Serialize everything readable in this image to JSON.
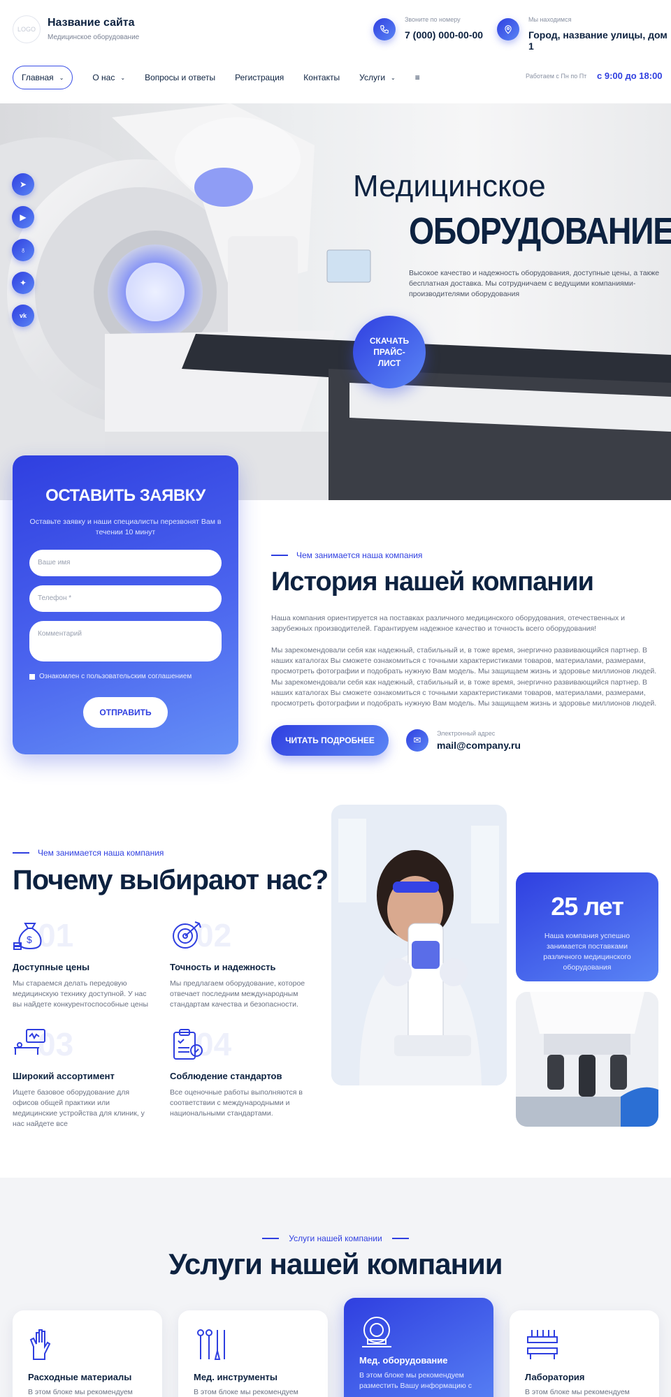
{
  "header": {
    "logo": "LOGO",
    "site_name": "Название сайта",
    "site_sub": "Медицинское оборудование",
    "phone_label": "Звоните по номеру",
    "phone": "7 (000) 000-00-00",
    "address_label": "Мы находимся",
    "address": "Город, название улицы, дом 1",
    "hours_label": "Работаем с Пн по Пт",
    "hours": "с 9:00 до 18:00",
    "nav": [
      {
        "label": "Главная"
      },
      {
        "label": "О нас"
      },
      {
        "label": "Вопросы и ответы"
      },
      {
        "label": "Регистрация"
      },
      {
        "label": "Контакты"
      },
      {
        "label": "Услуги"
      },
      {
        "label": "≡"
      }
    ]
  },
  "hero": {
    "title1": "Медицинское",
    "title2": "ОБОРУДОВАНИЕ",
    "desc": "Высокое качество и надежность оборудования, доступные цены, а также бесплатная доставка. Мы сотрудничаем с ведущими компаниями-производителями оборудования",
    "price_button": "СКАЧАТЬ ПРАЙС-ЛИСТ",
    "socials": [
      "telegram-icon",
      "youtube-icon",
      "odnoklassniki-icon",
      "twitter-icon",
      "vk-icon"
    ]
  },
  "form": {
    "title": "ОСТАВИТЬ ЗАЯВКУ",
    "subtitle": "Оставьте заявку и наши специалисты перезвонят  Вам в течении 10 минут",
    "name_placeholder": "Ваше имя",
    "phone_placeholder": "Телефон *",
    "comment_placeholder": "Комментарий",
    "agree": "Ознакомлен с пользовательским соглашением",
    "submit": "ОТПРАВИТЬ"
  },
  "history": {
    "eyebrow": "Чем занимается наша компания",
    "title": "История нашей компании",
    "p1": "Наша компания ориентируется на поставках различного медицинского оборудования, отечественных и зарубежных производителей. Гарантируем надежное качество и точность всего оборудования!",
    "p2": "Мы зарекомендовали себя как надежный, стабильный и, в тоже время, энергично развивающийся партнер. В наших каталогах Вы сможете ознакомиться с точными характеристиками товаров, материалами, размерами, просмотреть фотографии и подобрать нужную Вам модель. Мы защищаем жизнь и здоровье миллионов людей.",
    "p3": "Мы зарекомендовали себя как надежный, стабильный и, в тоже время, энергично развивающийся партнер. В наших каталогах Вы сможете ознакомиться с точными характеристиками товаров, материалами, размерами, просмотреть фотографии и подобрать нужную Вам модель. Мы защищаем жизнь и здоровье миллионов людей.",
    "more_button": "ЧИТАТЬ ПОДРОБНЕЕ",
    "mail_label": "Электронный адрес",
    "mail": "mail@company.ru"
  },
  "why": {
    "eyebrow": "Чем занимается наша компания",
    "title": "Почему выбирают нас?",
    "features": [
      {
        "num": "01",
        "icon": "money-bag-icon",
        "title": "Доступные цены",
        "text": "Мы стараемся делать передовую медицинскую технику доступной. У нас вы найдете конкурентоспособные цены"
      },
      {
        "num": "02",
        "icon": "target-icon",
        "title": "Точность и надежность",
        "text": "Мы предлагаем оборудование, которое отвечает последним международным стандартам качества и безопасности."
      },
      {
        "num": "03",
        "icon": "monitor-bed-icon",
        "title": "Широкий ассортимент",
        "text": "Ищете базовое оборудование для офисов общей практики или медицинские устройства для клиник, у нас найдете все"
      },
      {
        "num": "04",
        "icon": "clipboard-check-icon",
        "title": "Соблюдение стандартов",
        "text": "Все оценочные работы выполняются в соответствии с международными и национальными стандартами."
      }
    ],
    "years_value": "25 лет",
    "years_text": "Наша компания успешно занимается поставками различного медицинского оборудования"
  },
  "services": {
    "eyebrow": "Услуги нашей компании",
    "title": "Услуги нашей компании",
    "items": [
      {
        "icon": "gloves-icon",
        "name": "Расходные материалы",
        "text": "В этом блоке мы рекомендуем"
      },
      {
        "icon": "instruments-icon",
        "name": "Мед. инструменты",
        "text": "В этом блоке мы рекомендуем"
      },
      {
        "icon": "mri-scanner-icon",
        "name": "Мед. оборудование",
        "text": "В этом блоке мы рекомендуем разместить Вашу информацию с"
      },
      {
        "icon": "lab-rack-icon",
        "name": "Лаборатория",
        "text": "В этом блоке мы рекомендуем"
      }
    ]
  },
  "colors": {
    "accent": "#2f3fe0",
    "accent_light": "#5a85f5",
    "heading": "#0d2240"
  }
}
